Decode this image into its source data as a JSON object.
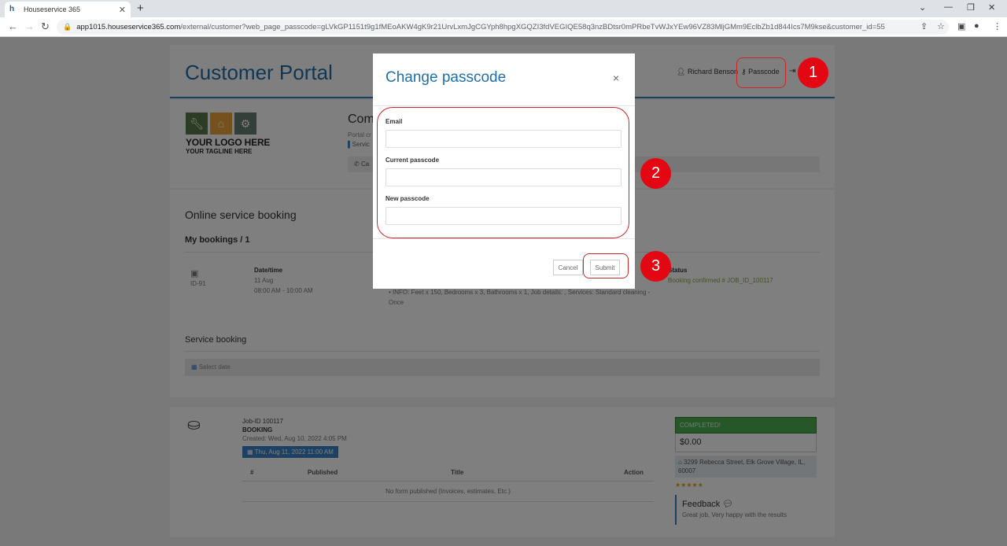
{
  "browser": {
    "tab_title": "Houseservice 365",
    "tab_favicon": "h",
    "tab_close": "✕",
    "new_tab": "+",
    "url_host": "app1015.houseservice365.com",
    "url_rest": "/external/customer?web_page_passcode=gLVkGP1151t9g1fMEoAKW4gK9r21UrvLxmJgCGYph8hpgXGQZI3fdVEGIQE58q3nzBDtsr0mPRbeTvWJxYEw96VZ83MljGMm9EclbZb1d844Ics7M9kse&customer_id=55"
  },
  "header": {
    "title": "Customer Portal",
    "user_name": "Richard Benson",
    "passcode_label": "Passcode"
  },
  "company": {
    "logo_main": "YOUR LOGO HERE",
    "logo_tagline": "YOUR TAGLINE HERE",
    "name": "Com",
    "sub": "Portal cr",
    "service": "Servic",
    "phone": "Ca"
  },
  "booking": {
    "title": "Online service booking",
    "subtitle": "My bookings / 1",
    "id": "ID-91",
    "datetime_label": "Date/time",
    "date": "11 Aug",
    "time": "08:00 AM - 10:00 AM",
    "info": "INFO: Feet x 150, Bedrooms x 3, Bathrooms x 1, Job details: , Services: Standard cleaning - Once",
    "status_label": "Status",
    "status": "Booking confirmed # JOB_ID_100117",
    "service_booking_title": "Service booking",
    "select_date": "Select date"
  },
  "job": {
    "id": "Job-ID 100117",
    "type": "BOOKING",
    "created": "Created: Wed, Aug 10, 2022 4:05 PM",
    "date": "Thu, Aug 11, 2022 11:00 AM",
    "table_headers": [
      "#",
      "Published",
      "Title",
      "Action"
    ],
    "empty_message": "No form published (Invoices, estimates, Etc.)",
    "status": "COMPLETED!",
    "price": "$0.00",
    "address": "3299 Rebecca Street, Elk Grove Village, IL, 60007",
    "rating": 5,
    "stars": "★★★★★",
    "feedback_title": "Feedback",
    "feedback_text": "Great job, Very happy with the results"
  },
  "modal": {
    "title": "Change passcode",
    "close": "×",
    "email_label": "Email",
    "email_value": "",
    "current_label": "Current passcode",
    "current_value": "",
    "new_label": "New passcode",
    "new_value": "",
    "cancel_label": "Cancel",
    "submit_label": "Submit"
  },
  "annotations": [
    "1",
    "2",
    "3"
  ],
  "colors": {
    "accent": "#1f6fa8",
    "annotation": "#e30613",
    "completed": "#4caf50"
  }
}
